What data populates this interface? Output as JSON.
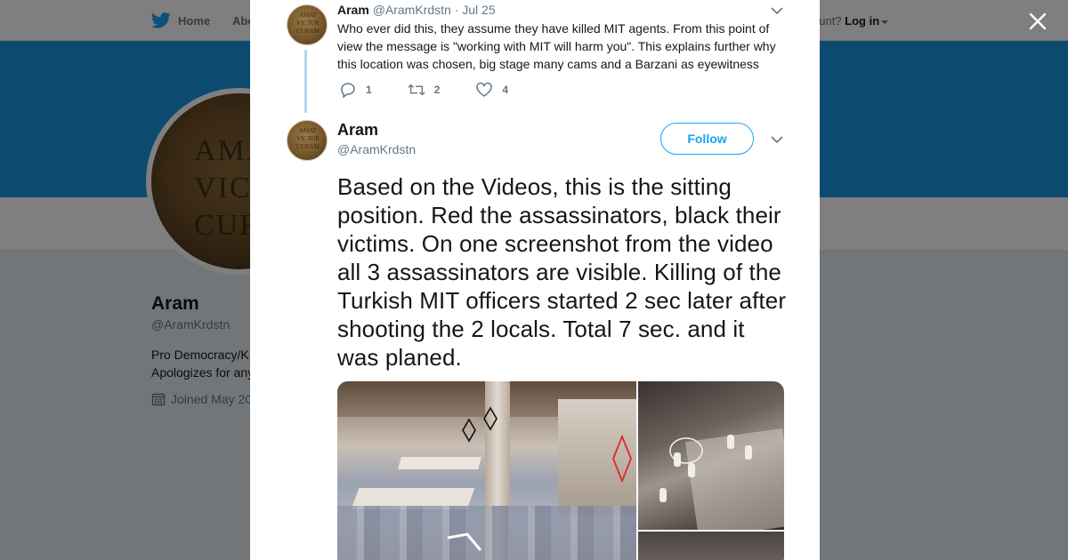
{
  "nav": {
    "home_label": "Home",
    "about_label": "Abo",
    "account_prompt": "ccount?",
    "login_label": "Log in"
  },
  "profile": {
    "name": "Aram",
    "handle": "@AramKrdstn",
    "bio_line1": "Pro Democracy/K",
    "bio_line2": "Apologizes for any",
    "joined": "Joined May 20",
    "avatar_text": "AMA\nVICTO\nCURA"
  },
  "modal": {
    "reply": {
      "name": "Aram",
      "handle": "@AramKrdstn",
      "separator": "·",
      "date": "Jul 25",
      "text": "Who ever did this, they assume they have killed MIT agents. From this point of view the message is \"working with MIT will harm you\". This explains further why this location was chosen, big stage many cams and a Barzani as eyewitness",
      "reply_count": "1",
      "retweet_count": "2",
      "like_count": "4"
    },
    "tweet": {
      "name": "Aram",
      "handle": "@AramKrdstn",
      "follow_label": "Follow",
      "text": "Based on the Videos, this is the sitting position. Red the assassinators, black their victims. On one screenshot from the video all 3 assassinators are visible. Killing of the Turkish MIT officers started 2 sec later after shooting the 2 locals. Total 7 sec. and it was planed."
    }
  },
  "colors": {
    "banner": "#1b95e0",
    "accent": "#1da1f2",
    "thread_line": "#b0d7f3",
    "marker_red": "#e0262b",
    "marker_black": "#111111"
  },
  "icons": {
    "close": "close-icon",
    "twitter": "twitter-bird-icon",
    "reply": "reply-icon",
    "retweet": "retweet-icon",
    "like": "heart-icon",
    "more": "chevron-down-icon",
    "calendar": "calendar-icon"
  }
}
